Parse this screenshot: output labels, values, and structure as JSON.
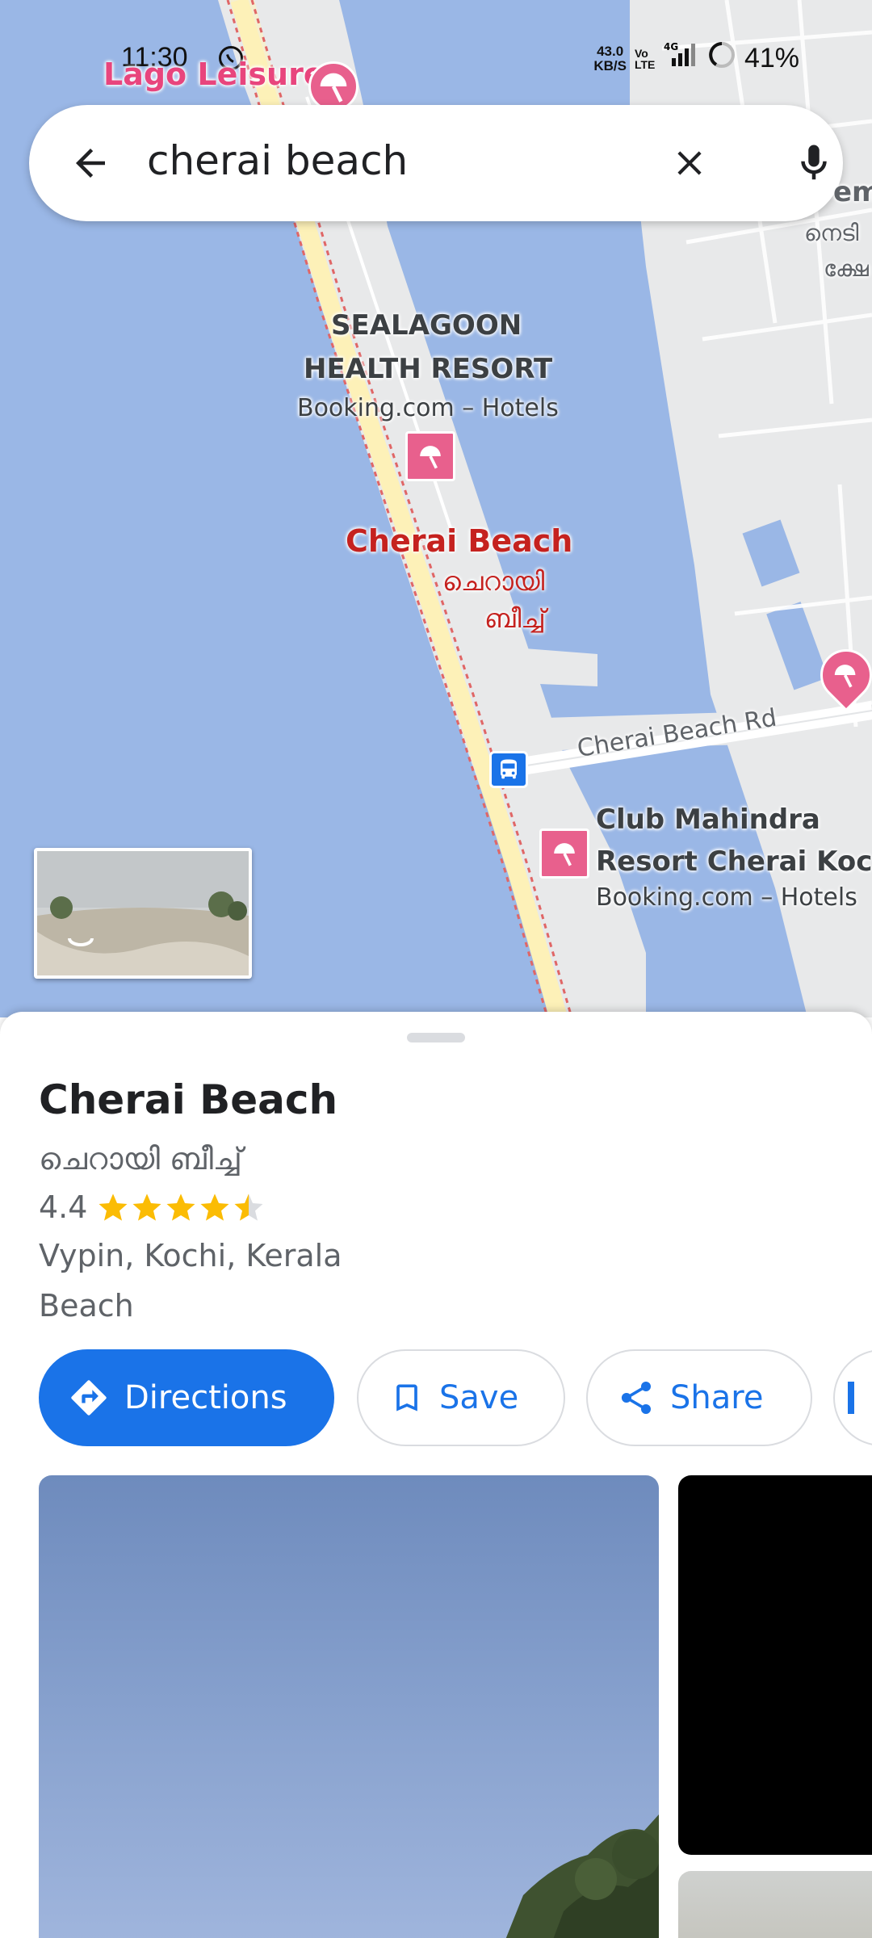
{
  "status_bar": {
    "time": "11:30",
    "net_speed_value": "43.0",
    "net_speed_unit": "KB/S",
    "volte": "Vo LTE",
    "network": "4G",
    "battery": "41%"
  },
  "search": {
    "query": "cherai beach"
  },
  "map": {
    "labels": {
      "lago_leisure": "Lago Leisure",
      "sealagoon_line1": "SEALAGOON",
      "sealagoon_line2": "HEALTH RESORT",
      "sealagoon_sub": "Booking.com – Hotels",
      "cherai_beach": "Cherai Beach",
      "cherai_ml_line1": "ചെറായി",
      "cherai_ml_line2": "ബീച്ച്",
      "road": "Cherai Beach Rd",
      "club_line1": "Club Mahindra",
      "club_line2": "Resort Cherai Koc",
      "club_sub": "Booking.com – Hotels",
      "edge_top": "em",
      "edge_ml1": "നെടി",
      "edge_ml2": "ക്ഷേ"
    }
  },
  "place": {
    "name": "Cherai Beach",
    "name_local": "ചെറായി ബീച്ച്",
    "rating": "4.4",
    "rating_value": 4.4,
    "location": "Vypin, Kochi, Kerala",
    "category": "Beach"
  },
  "actions": {
    "directions": "Directions",
    "save": "Save",
    "share": "Share"
  },
  "colors": {
    "accent": "#1a73e8",
    "star": "#fbbc04",
    "water": "#9ab7e6",
    "poi_pink": "#e8608d",
    "place_red": "#c5221f"
  }
}
